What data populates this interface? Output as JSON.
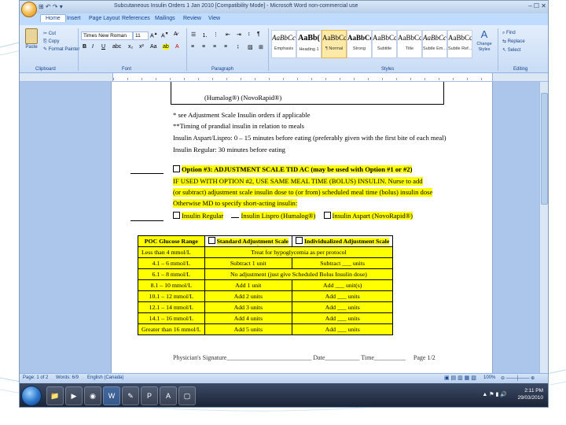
{
  "window": {
    "title": "Subcutaneous Insulin Orders 1 Jan 2010 [Compatibility Mode] - Microsoft Word non-commercial use",
    "qat": "⊞ ↶ ↷ ▾",
    "controls": "–  ☐  ✕"
  },
  "tabs": [
    "Home",
    "Insert",
    "Page Layout",
    "References",
    "Mailings",
    "Review",
    "View"
  ],
  "ribbon": {
    "clipboard": {
      "paste": "Paste",
      "cut": "Cut",
      "copy": "Copy",
      "format_painter": "Format Painter",
      "label": "Clipboard"
    },
    "font": {
      "name": "Times New Roman",
      "size": "11",
      "label": "Font"
    },
    "paragraph": {
      "label": "Paragraph"
    },
    "styles": {
      "items": [
        {
          "sample": "AaBbCcI",
          "name": "Emphasis"
        },
        {
          "sample": "AaBb(",
          "name": "Heading 1"
        },
        {
          "sample": "AaBbCcI",
          "name": "¶ Normal"
        },
        {
          "sample": "AaBbCcl",
          "name": "Strong"
        },
        {
          "sample": "AaBbCcl",
          "name": "Subtitle"
        },
        {
          "sample": "AaBbCcI",
          "name": "Title"
        },
        {
          "sample": "AaBbCcI",
          "name": "Subtle Em..."
        },
        {
          "sample": "AaBbCcI",
          "name": "Subtle Ref..."
        }
      ],
      "change_styles": "Change Styles",
      "label": "Styles"
    },
    "editing": {
      "find": "Find",
      "replace": "Replace",
      "select": "Select",
      "label": "Editing"
    }
  },
  "document": {
    "top_row": "(Humalog®) (NovoRapid®)",
    "notes": [
      "* see Adjustment Scale Insulin orders if applicable",
      "**Timing of prandial insulin in relation to meals",
      "Insulin Aspart/Lispro: 0 – 15 minutes before eating (preferably given with the first bite of each meal)",
      "Insulin Regular: 30 minutes before eating"
    ],
    "option3": {
      "heading": "Option #3: ADJUSTMENT SCALE  TID AC (may be used with Option #1 or #2)",
      "lines": [
        "IF USED WITH OPTION #2, USE SAME MEAL TIME (BOLUS) INSULIN.  Nurse to add",
        "(or subtract) adjustment scale insulin dose to (or from) scheduled meal time (bolus) insulin dose",
        "Otherwise MD to specify short-acting insulin:"
      ],
      "choices": [
        "Insulin Regular",
        "Insulin Lispro (Humalog®)",
        "Insulin Aspart (NovoRapid®)"
      ]
    },
    "table": {
      "headers": [
        "POC Glucose Range",
        "Standard Adjustment Scale",
        "Individualized Adjustment Scale"
      ],
      "rows": [
        {
          "range": "Less than 4 mmol/L",
          "standard": "Treat for hypoglycemia as per protocol",
          "individual": ""
        },
        {
          "range": "4.1 – 6 mmol/L",
          "standard": "Subtract 1 unit",
          "individual": "Subtract ___ units"
        },
        {
          "range": "6.1 – 8 mmol/L",
          "standard": "No adjustment (just give Scheduled Bolus Insulin dose)",
          "individual": ""
        },
        {
          "range": "8.1 – 10 mmol/L",
          "standard": "Add 1 unit",
          "individual": "Add ___ unit(s)"
        },
        {
          "range": "10.1 – 12 mmol/L",
          "standard": "Add 2 units",
          "individual": "Add ___ units"
        },
        {
          "range": "12.1 – 14 mmol/L",
          "standard": "Add 3 units",
          "individual": "Add ___ units"
        },
        {
          "range": "14.1 – 16 mmol/L",
          "standard": "Add 4 units",
          "individual": "Add ___ units"
        },
        {
          "range": "Greater than 16 mmol/L",
          "standard": "Add 5 units",
          "individual": "Add ___ units"
        }
      ]
    },
    "footer": {
      "signature": "Physician's Signature___________________________",
      "date": "Date___________",
      "time": "Time__________",
      "page": "Page 1/2"
    }
  },
  "statusbar": {
    "page": "Page: 1 of 2",
    "words": "Words: 6/9",
    "language": "English (Canada)",
    "zoom": "100%"
  },
  "taskbar": {
    "time": "2:11 PM",
    "date": "29/03/2010"
  },
  "colors": {
    "highlight": "#ffff00",
    "ribbon": "#c9dcf5",
    "taskbar": "#1b2436"
  }
}
